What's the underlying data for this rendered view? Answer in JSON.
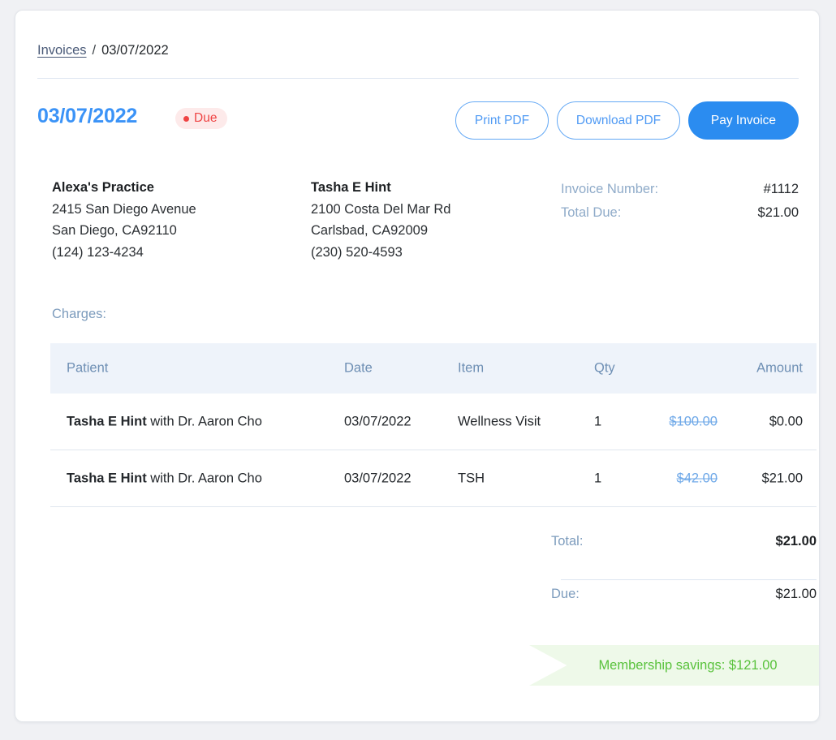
{
  "breadcrumb": {
    "link": "Invoices",
    "separator": "/",
    "current": "03/07/2022"
  },
  "header": {
    "title": "03/07/2022",
    "status_badge": "Due",
    "status_color": "#ef4444",
    "status_bg": "#fdeaea",
    "accent_color": "#3b93f7",
    "buttons": {
      "print": "Print PDF",
      "download": "Download PDF",
      "pay": "Pay Invoice"
    }
  },
  "practice": {
    "name": "Alexa's Practice",
    "street": "2415 San Diego Avenue",
    "city_state_zip": "San Diego, CA92110",
    "phone": "(124) 123-4234"
  },
  "patient": {
    "name": "Tasha E Hint",
    "street": "2100 Costa Del Mar Rd",
    "city_state_zip": "Carlsbad, CA92009",
    "phone": "(230) 520-4593"
  },
  "meta": {
    "invoice_number_label": "Invoice Number:",
    "invoice_number_value": "#1112",
    "total_due_label": "Total Due:",
    "total_due_value": "$21.00"
  },
  "charges": {
    "label": "Charges:",
    "columns": {
      "patient": "Patient",
      "date": "Date",
      "item": "Item",
      "qty": "Qty",
      "amount": "Amount"
    },
    "rows": [
      {
        "patient_name": "Tasha E Hint",
        "patient_provider": " with Dr. Aaron Cho",
        "date": "03/07/2022",
        "item": "Wellness Visit",
        "qty": "1",
        "original_amount": "$100.00",
        "amount": "$0.00"
      },
      {
        "patient_name": "Tasha E Hint",
        "patient_provider": " with Dr. Aaron Cho",
        "date": "03/07/2022",
        "item": "TSH",
        "qty": "1",
        "original_amount": "$42.00",
        "amount": "$21.00"
      }
    ]
  },
  "totals": {
    "total_label": "Total:",
    "total_value": "$21.00",
    "due_label": "Due:",
    "due_value": "$21.00"
  },
  "savings": {
    "text": "Membership savings: $121.00",
    "color": "#59c23c",
    "bg": "#eef9e9"
  }
}
